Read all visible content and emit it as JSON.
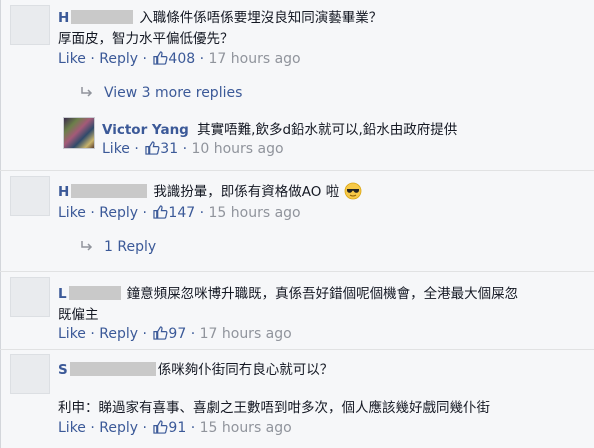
{
  "comments": [
    {
      "name": "H",
      "text_line1": "入職條件係唔係要埋沒良知同演藝畢業？",
      "text_line2": "厚面皮，智力水平偏低優先？",
      "like": "Like",
      "sep1": "·",
      "reply": "Reply",
      "sep2": "·",
      "likes": "408",
      "sep3": "·",
      "time": "17 hours ago"
    },
    {
      "name": "Victor Yang",
      "text_line1": "其實唔難,飲多d鉛水就可以,鉛水由政府提供",
      "like": "Like",
      "sep1": "·",
      "likes": "31",
      "sep2": "·",
      "time": "10 hours ago"
    },
    {
      "name": "H",
      "text_line1": "我識扮暈，即係有資格做AO 啦",
      "like": "Like",
      "sep1": "·",
      "reply": "Reply",
      "sep2": "·",
      "likes": "147",
      "sep3": "·",
      "time": "15 hours ago"
    },
    {
      "name": "L",
      "text_line1": "鐘意頻屎忽咪博升職既，真係吾好錯個呢個機會，全港最大個屎忽",
      "text_line2": "既僱主",
      "like": "Like",
      "sep1": "·",
      "reply": "Reply",
      "sep2": "·",
      "likes": "97",
      "sep3": "·",
      "time": "17 hours ago"
    },
    {
      "name": "S",
      "text_line1": "係咪夠仆街同冇良心就可以？",
      "text_line2": "利申：睇過家有喜事、喜劇之王數唔到咁多次，個人應該幾好戲同幾仆街",
      "like": "Like",
      "sep1": "·",
      "reply": "Reply",
      "sep2": "·",
      "likes": "91",
      "sep3": "·",
      "time": "15 hours ago"
    }
  ],
  "replies": {
    "view_more": "View 3 more replies",
    "one_reply": "1 Reply"
  },
  "colors": {
    "link": "#3b5998",
    "meta": "#90949c",
    "text": "#141823"
  }
}
